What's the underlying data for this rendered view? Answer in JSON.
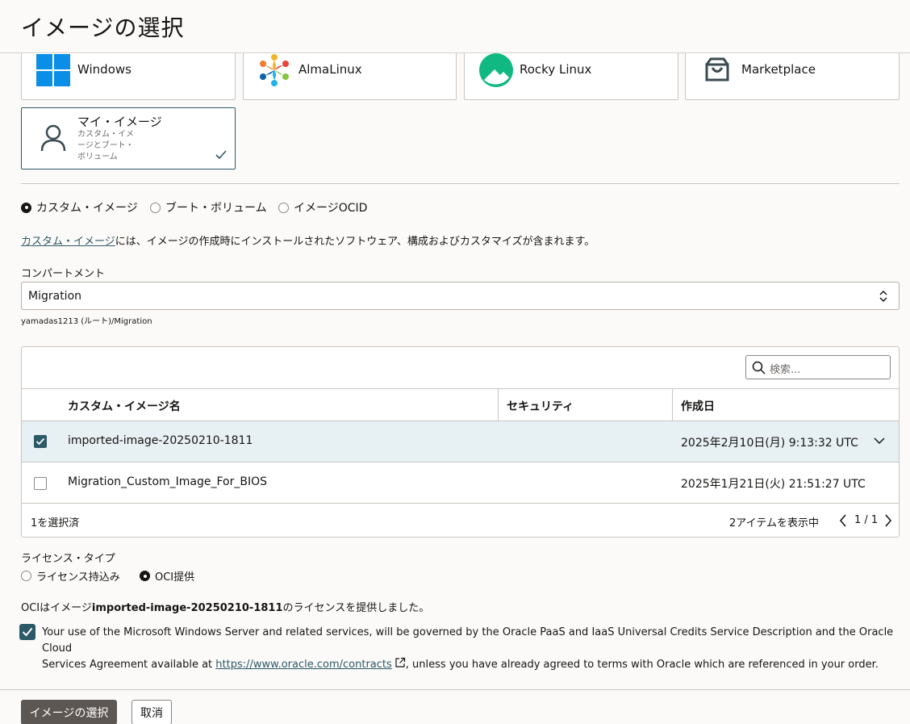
{
  "header": {
    "title": "イメージの選択"
  },
  "tiles": [
    {
      "label": "Windows"
    },
    {
      "label": "AlmaLinux"
    },
    {
      "label": "Rocky Linux"
    },
    {
      "label": "Marketplace"
    }
  ],
  "my_image_tile": {
    "title": "マイ・イメージ",
    "desc_line1": "カスタム・イメ",
    "desc_line2": "ージとブート・",
    "desc_line3": "ボリューム"
  },
  "source_options": [
    {
      "label": "カスタム・イメージ",
      "selected": true
    },
    {
      "label": "ブート・ボリューム",
      "selected": false
    },
    {
      "label": "イメージOCID",
      "selected": false
    }
  ],
  "description": {
    "link": "カスタム・イメージ",
    "text": "には、イメージの作成時にインストールされたソフトウェア、構成およびカスタマイズが含まれます。"
  },
  "compartment": {
    "label": "コンパートメント",
    "value": "Migration",
    "path": "yamadas1213 (ルート)/Migration"
  },
  "table": {
    "search_placeholder": "検索...",
    "columns": [
      "カスタム・イメージ名",
      "セキュリティ",
      "作成日"
    ],
    "rows": [
      {
        "name": "imported-image-20250210-1811",
        "security": "",
        "created": "2025年2月10日(月) 9:13:32 UTC",
        "checked": true
      },
      {
        "name": "Migration_Custom_Image_For_BIOS",
        "security": "",
        "created": "2025年1月21日(火) 21:51:27 UTC",
        "checked": false
      }
    ],
    "selected_count": "1を選択済",
    "items_shown": "2アイテムを表示中",
    "pagination": "1 / 1"
  },
  "license": {
    "label": "ライセンス・タイプ",
    "options": [
      {
        "label": "ライセンス持込み",
        "selected": false
      },
      {
        "label": "OCI提供",
        "selected": true
      }
    ],
    "notice_prefix": "OCIはイメージ",
    "notice_image": "imported-image-20250210-1811",
    "notice_suffix": "のライセンスを提供しました。"
  },
  "agreement": {
    "checked": true,
    "text_part1": "Your use of the Microsoft Windows Server and related services, will be governed by the Oracle PaaS and IaaS Universal Credits Service Description and the Oracle Cloud",
    "text_part2": "Services Agreement available at ",
    "link": "https://www.oracle.com/contracts",
    "text_part3": ", unless you have already agreed to terms with Oracle which are referenced in your order."
  },
  "footer": {
    "select_button": "イメージの選択",
    "cancel_button": "取消"
  },
  "colors": {
    "accent": "#2c5967",
    "selected_row": "#e7f0f3",
    "primary_button": "#5c5753",
    "windows": "#0a8ee6",
    "rocky": "#10b981"
  }
}
